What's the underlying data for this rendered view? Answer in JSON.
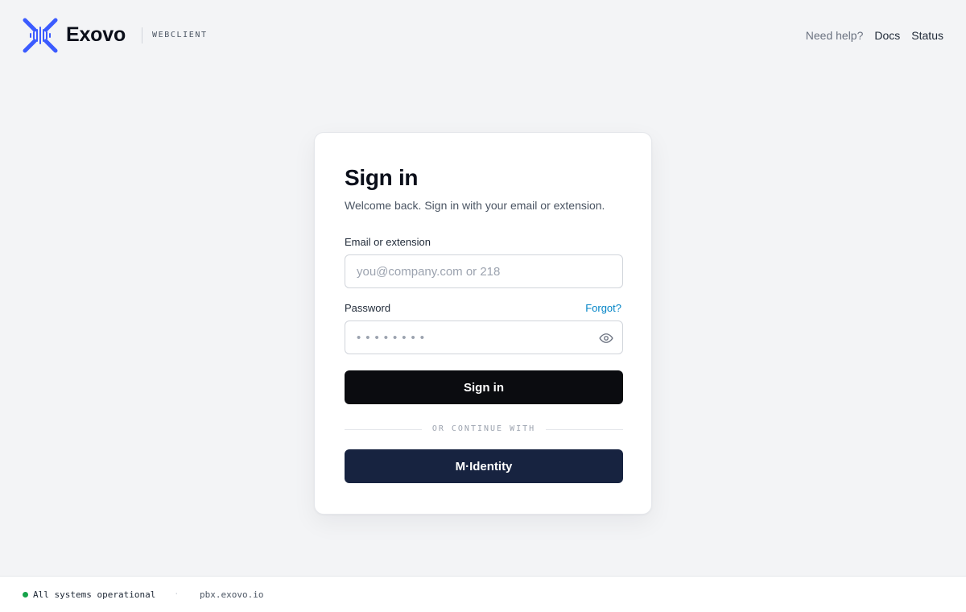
{
  "header": {
    "brand_name": "Exovo",
    "brand_tag": "WEBCLIENT",
    "help_text": "Need help?",
    "nav_links": [
      "Docs",
      "Status"
    ]
  },
  "signin": {
    "title": "Sign in",
    "subtitle": "Welcome back. Sign in with your email or extension.",
    "email_label": "Email or extension",
    "email_placeholder": "you@company.com or 218",
    "email_value": "",
    "password_label": "Password",
    "forgot_label": "Forgot?",
    "password_placeholder": "••••••••",
    "password_value": "",
    "submit_label": "Sign in",
    "divider_text": "OR CONTINUE WITH",
    "sso_label": "M·Identity"
  },
  "footer": {
    "status_text": "All systems operational",
    "separator": "·",
    "host": "pbx.exovo.io"
  },
  "colors": {
    "accent_blue": "#3b5bff",
    "link": "#0284c7",
    "primary_button": "#0b0c10",
    "sso_button": "#172340",
    "status_ok": "#16a34a"
  },
  "icons": {
    "logo": "exovo-logo-icon",
    "password_toggle": "eye-icon",
    "status": "status-dot-icon"
  }
}
